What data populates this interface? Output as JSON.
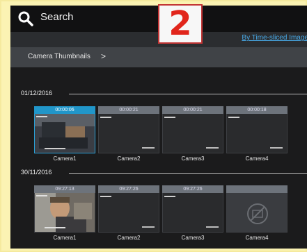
{
  "header": {
    "search_label": "Search"
  },
  "toolbar": {
    "time_sliced_link": "By Time-sliced Image"
  },
  "breadcrumb": {
    "label": "Camera Thumbnails",
    "chevron": ">"
  },
  "badge": {
    "number": "2"
  },
  "groups": [
    {
      "date": "01/12/2016",
      "cameras": [
        {
          "time": "00:00:06",
          "name": "Camera1"
        },
        {
          "time": "00:00:21",
          "name": "Camera2"
        },
        {
          "time": "00:00:21",
          "name": "Camera3"
        },
        {
          "time": "00:00:18",
          "name": "Camera4"
        }
      ]
    },
    {
      "date": "30/11/2016",
      "cameras": [
        {
          "time": "09:27:13",
          "name": "Camera1"
        },
        {
          "time": "09:27:26",
          "name": "Camera2"
        },
        {
          "time": "09:27:26",
          "name": "Camera3"
        },
        {
          "time": "",
          "name": "Camera4"
        }
      ]
    }
  ],
  "colors": {
    "accent": "#2196c9",
    "link": "#48a9e6",
    "badge_text": "#e1251b",
    "background": "#fbf3b3"
  }
}
